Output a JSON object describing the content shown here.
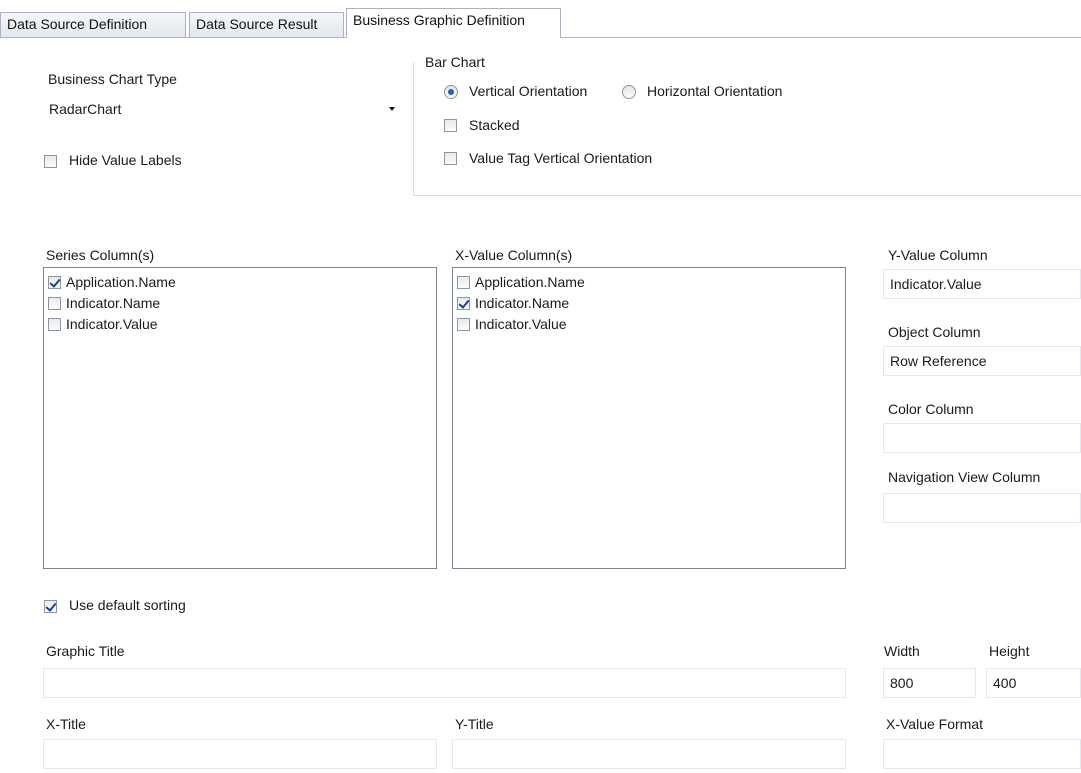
{
  "tabs": [
    {
      "label": "Data Source Definition"
    },
    {
      "label": "Data Source Result"
    },
    {
      "label": "Business Graphic Definition"
    }
  ],
  "chart_type": {
    "label": "Business Chart Type",
    "value": "RadarChart"
  },
  "hide_value_labels": {
    "label": "Hide Value Labels",
    "checked": false
  },
  "bar_chart": {
    "title": "Bar Chart",
    "vertical_label": "Vertical Orientation",
    "horizontal_label": "Horizontal Orientation",
    "orientation": "vertical",
    "stacked_label": "Stacked",
    "stacked": false,
    "value_tag_label": "Value Tag Vertical Orientation",
    "value_tag": false
  },
  "series_columns": {
    "label": "Series Column(s)",
    "items": [
      {
        "label": "Application.Name",
        "checked": true
      },
      {
        "label": "Indicator.Name",
        "checked": false
      },
      {
        "label": "Indicator.Value",
        "checked": false
      }
    ]
  },
  "xvalue_columns": {
    "label": "X-Value Column(s)",
    "items": [
      {
        "label": "Application.Name",
        "checked": false
      },
      {
        "label": "Indicator.Name",
        "checked": true
      },
      {
        "label": "Indicator.Value",
        "checked": false
      }
    ]
  },
  "yvalue_column": {
    "label": "Y-Value Column",
    "value": "Indicator.Value"
  },
  "object_column": {
    "label": "Object Column",
    "value": "Row Reference"
  },
  "color_column": {
    "label": "Color Column",
    "value": ""
  },
  "navigation_view_column": {
    "label": "Navigation View Column",
    "value": ""
  },
  "default_sorting": {
    "label": "Use default sorting",
    "checked": true
  },
  "graphic_title": {
    "label": "Graphic Title",
    "value": ""
  },
  "width": {
    "label": "Width",
    "value": "800"
  },
  "height": {
    "label": "Height",
    "value": "400"
  },
  "x_title": {
    "label": "X-Title",
    "value": ""
  },
  "y_title": {
    "label": "Y-Title",
    "value": ""
  },
  "xvalue_format": {
    "label": "X-Value Format",
    "value": ""
  }
}
